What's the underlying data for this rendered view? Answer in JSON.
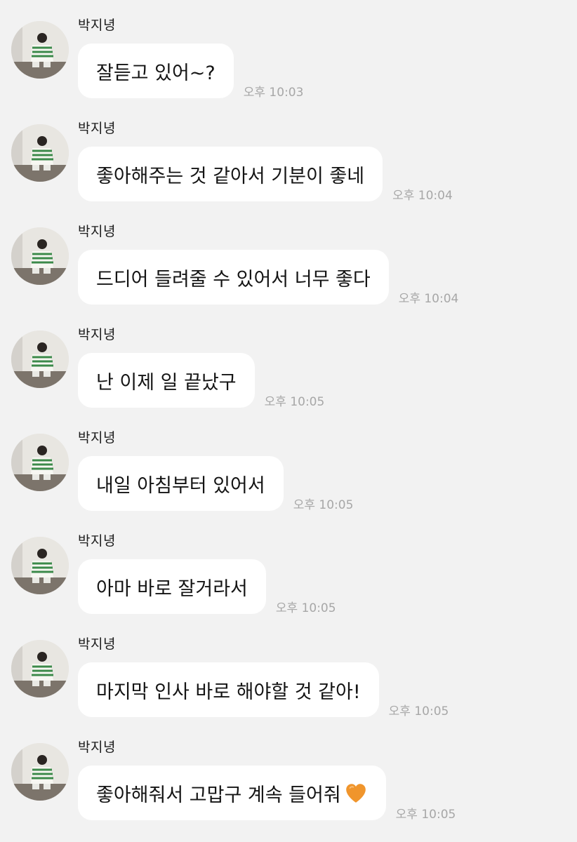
{
  "sender_name": "박지녕",
  "messages": [
    {
      "text": "잘듣고 있어~?",
      "time": "오후 10:03"
    },
    {
      "text": "좋아해주는 것 같아서 기분이 좋네",
      "time": "오후 10:04"
    },
    {
      "text": "드디어 들려줄 수 있어서 너무 좋다",
      "time": "오후 10:04"
    },
    {
      "text": "난 이제 일 끝났구",
      "time": "오후 10:05"
    },
    {
      "text": "내일 아침부터 있어서",
      "time": "오후 10:05"
    },
    {
      "text": "아마 바로 잘거라서",
      "time": "오후 10:05"
    },
    {
      "text": "마지막 인사 바로 해야할 것 같아!",
      "time": "오후 10:05"
    },
    {
      "text": "좋아해줘서 고맙구 계속 들어줘",
      "time": "오후 10:05",
      "emoji": "orange-heart-icon"
    }
  ],
  "colors": {
    "background": "#f2f2f2",
    "bubble": "#ffffff",
    "time_text": "#a7a7a7",
    "heart": "#f0952c"
  }
}
